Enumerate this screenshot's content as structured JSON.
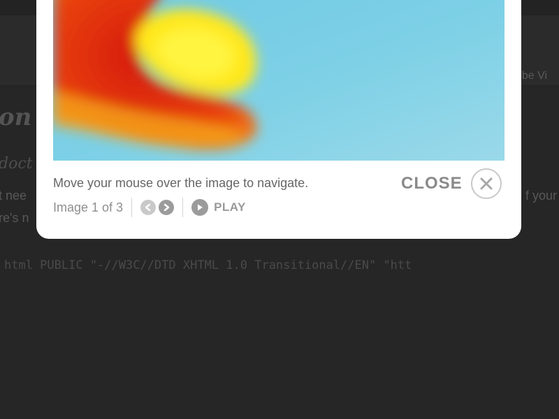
{
  "background": {
    "nav_text": "ube Vi",
    "heading": "on",
    "subheading": "doct",
    "line1_left": "t nee",
    "line1_right": "f your",
    "line2_left": "re's n",
    "code": "html PUBLIC \"-//W3C//DTD XHTML 1.0 Transitional//EN\" \"htt"
  },
  "lightbox": {
    "caption": "Move your mouse over the image to navigate.",
    "counter": "Image 1 of 3",
    "close_label": "CLOSE",
    "play_label": "PLAY",
    "icons": {
      "close": "close-icon",
      "prev": "arrow-left-icon",
      "next": "arrow-right-icon",
      "play": "play-icon"
    }
  },
  "colors": {
    "overlay": "#262626",
    "lightbox_bg": "#ffffff",
    "sky": "#7dd0e6",
    "flame_red": "#e02a10",
    "flame_yellow": "#fff21a"
  }
}
